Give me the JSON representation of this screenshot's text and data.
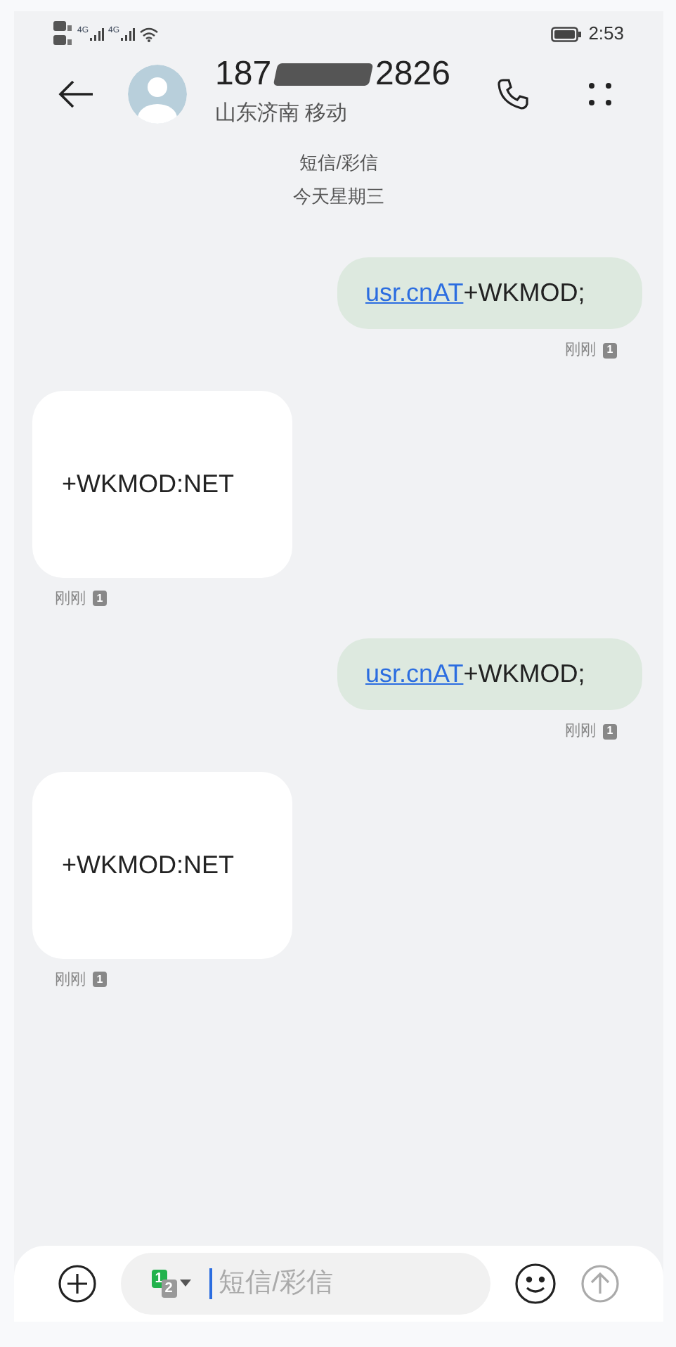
{
  "status_bar": {
    "network_labels": [
      "4G",
      "4G"
    ],
    "time": "2:53"
  },
  "header": {
    "number_start": "187",
    "number_end": "2826",
    "location": "山东济南 移动"
  },
  "thread_info": {
    "channel": "短信/彩信",
    "date": "今天星期三"
  },
  "messages": [
    {
      "kind": "sent",
      "link": "usr.cnAT",
      "text": "+WKMOD;",
      "meta": "刚刚",
      "sim": "1"
    },
    {
      "kind": "received",
      "text": "+WKMOD:NET",
      "meta": "刚刚",
      "sim": "1"
    },
    {
      "kind": "sent",
      "link": "usr.cnAT",
      "text": "+WKMOD;",
      "meta": "刚刚",
      "sim": "1"
    },
    {
      "kind": "received",
      "text": "+WKMOD:NET",
      "meta": "刚刚",
      "sim": "1"
    }
  ],
  "composer": {
    "sim_primary": "1",
    "sim_secondary": "2",
    "placeholder": "短信/彩信"
  }
}
